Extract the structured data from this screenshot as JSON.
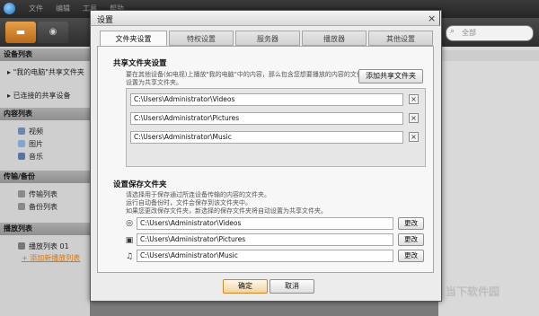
{
  "menu": [
    "文件",
    "编辑",
    "工具",
    "帮助"
  ],
  "search": {
    "placeholder": "全部"
  },
  "sidebar": {
    "sections": [
      {
        "title": "设备列表",
        "items": [
          {
            "label": "\"我的电脑\"共享文件夹"
          },
          {
            "label": "已连接的共享设备"
          }
        ]
      },
      {
        "title": "内容列表",
        "items": [
          {
            "label": "视频"
          },
          {
            "label": "图片"
          },
          {
            "label": "音乐"
          }
        ]
      },
      {
        "title": "传输/备份",
        "items": [
          {
            "label": "传输列表"
          },
          {
            "label": "备份列表"
          }
        ]
      },
      {
        "title": "播放列表",
        "items": [
          {
            "label": "播放列表 01"
          },
          {
            "label": "添加新播放列表"
          }
        ]
      }
    ]
  },
  "dialog": {
    "title": "设置",
    "close": "×",
    "tabs": [
      "文件夹设置",
      "特权设置",
      "服务器",
      "播放器",
      "其他设置"
    ],
    "share": {
      "header": "共享文件夹设置",
      "desc1": "要在其他设备(如电视)上播放\"我的电脑\"中的内容，那么包含您想要播放的内容的文件夹必须",
      "desc2": "设置为共享文件夹。",
      "add_label": "添加共享文件夹",
      "paths": [
        "C:\\Users\\Administrator\\Videos",
        "C:\\Users\\Administrator\\Pictures",
        "C:\\Users\\Administrator\\Music"
      ],
      "remove": "×"
    },
    "save": {
      "header": "设置保存文件夹",
      "desc1": "请选择用于保存通过所连设备传输的内容的文件夹。",
      "desc2": "运行自动备份时，文件会保存到该文件夹中。",
      "desc3": "如果您更改保存文件夹，新选择的保存文件夹将自动设置为共享文件夹。",
      "paths": [
        "C:\\Users\\Administrator\\Videos",
        "C:\\Users\\Administrator\\Pictures",
        "C:\\Users\\Administrator\\Music"
      ],
      "change_label": "更改"
    },
    "ok_label": "确定",
    "cancel_label": "取消"
  },
  "watermark": "当下软件园",
  "colors": {
    "accent": "#e8a04a",
    "titlebar": "#2e2e2e",
    "dialog_bg": "#ececec"
  }
}
